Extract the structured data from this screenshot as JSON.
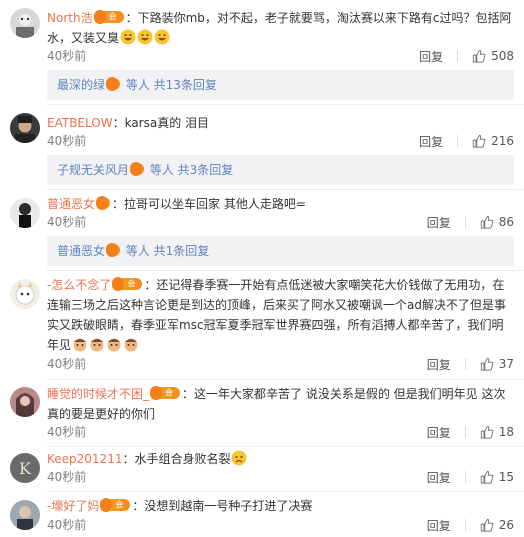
{
  "comments": [
    {
      "username": "North浩",
      "vip_label": "会员",
      "text": "：下路装你mb，对不起，老子就要骂，淘汰赛以来下路有c过吗？包括阿水，又装又臭",
      "emojis": 3,
      "time": "40秒前",
      "reply_label": "回复",
      "likes": "508",
      "sub": {
        "name": "最深的绿",
        "suffix": "等人 共13条回复"
      }
    },
    {
      "username": "EATBELOW",
      "vip_label": "",
      "text": "：karsa真的 泪目",
      "emojis": 0,
      "time": "40秒前",
      "reply_label": "回复",
      "likes": "216",
      "sub": {
        "name": "子规无关风月",
        "suffix": "等人 共3条回复"
      }
    },
    {
      "username": "普通恶女",
      "vip_label": "",
      "text": "：拉哥可以坐车回家 其他人走路吧=",
      "emojis": 0,
      "time": "40秒前",
      "reply_label": "回复",
      "likes": "86",
      "sub": {
        "name": "普通恶女",
        "suffix": "等人 共1条回复"
      }
    },
    {
      "username": "-怎么不念了",
      "vip_label": "会员",
      "text": "：还记得春季赛一开始有点低迷被大家嘲笑花大价钱做了无用功，在连输三场之后这种言论更是到达的顶峰，后来买了阿水又被嘲讽一个ad解决不了但是事实又跌破眼睛，春季亚军msc冠军夏季冠军世界赛四强，所有滔搏人都辛苦了，我们明年见",
      "emojis": 4,
      "time": "40秒前",
      "reply_label": "回复",
      "likes": "37"
    },
    {
      "username": "睡觉的时候才不困_",
      "vip_label": "会员",
      "text": "：这一年大家都辛苦了 说没关系是假的 但是我们明年见 这次真的要是更好的你们",
      "emojis": 0,
      "time": "40秒前",
      "reply_label": "回复",
      "likes": "18"
    },
    {
      "username": "Keep201211",
      "vip_label": "",
      "text": "：水手组合身败名裂",
      "emojis": 1,
      "time": "40秒前",
      "reply_label": "回复",
      "likes": "15"
    },
    {
      "username": "-壕好了妈",
      "vip_label": "会员",
      "text": "：没想到越南一号种子打进了决赛",
      "emojis": 0,
      "time": "40秒前",
      "reply_label": "回复",
      "likes": "26"
    }
  ]
}
